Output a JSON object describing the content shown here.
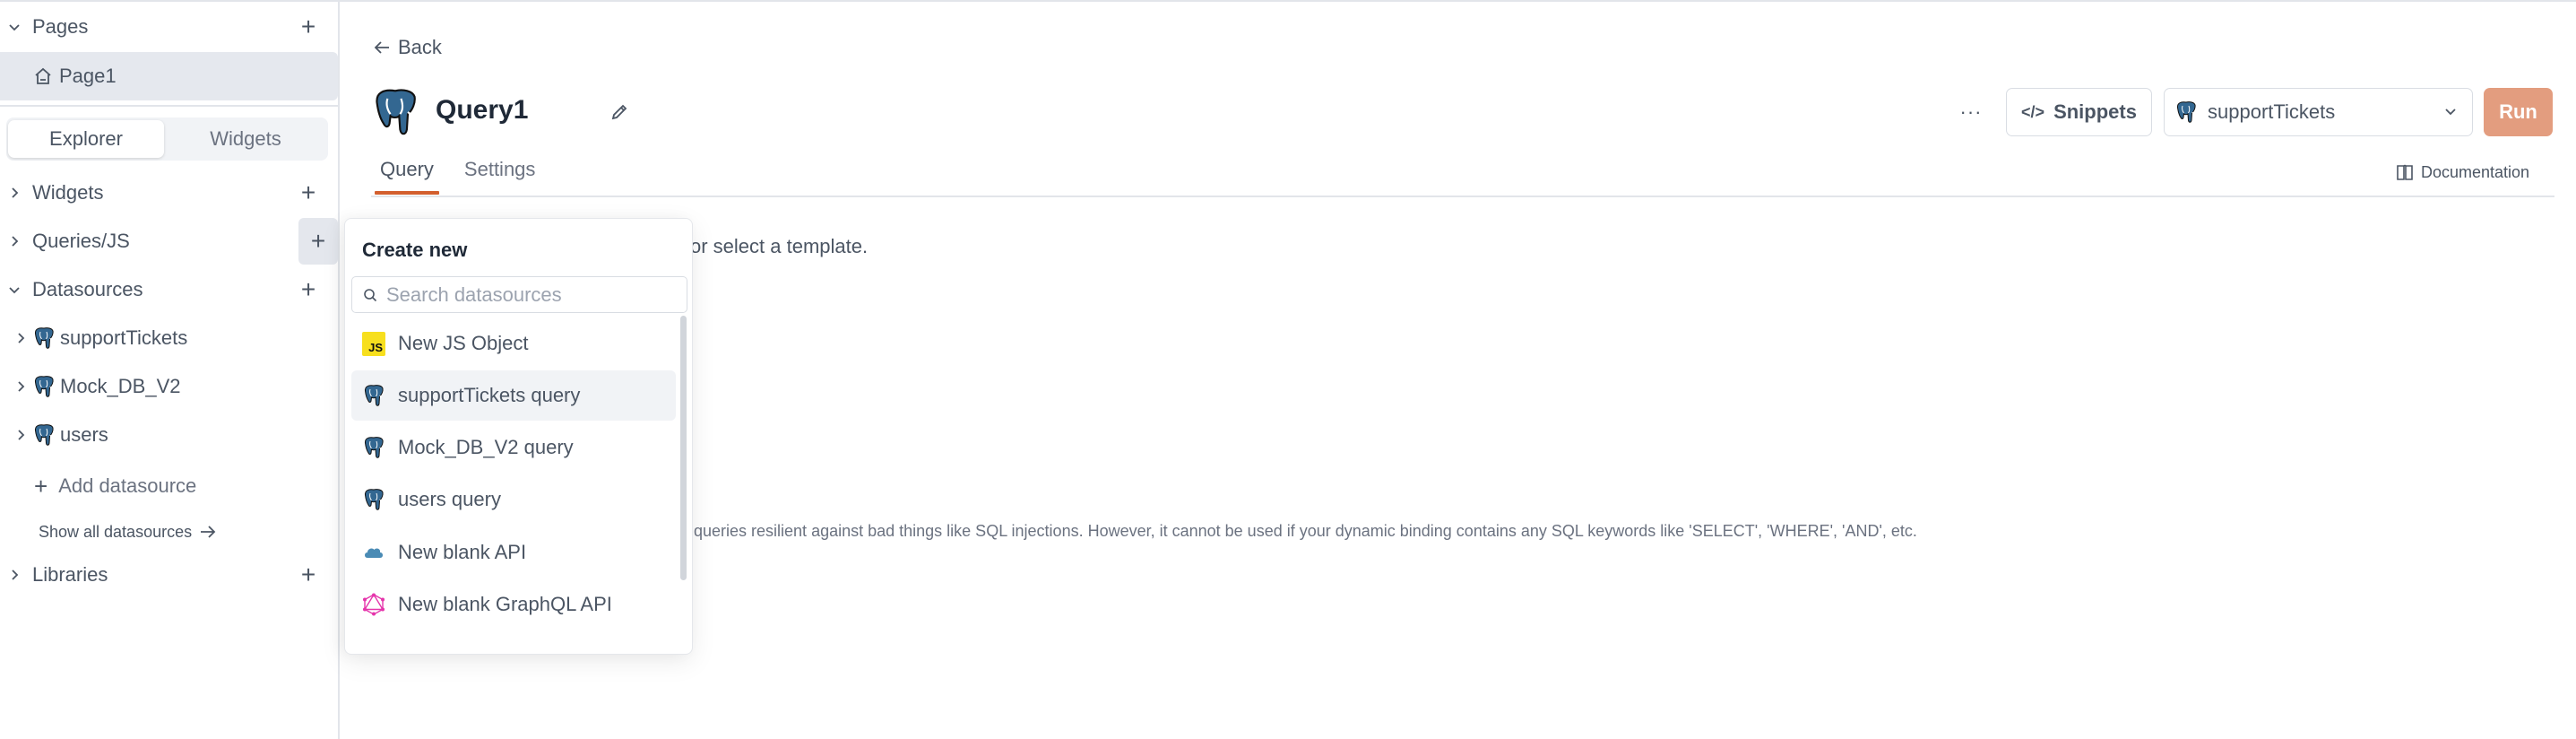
{
  "sidebar": {
    "pages": {
      "label": "Pages",
      "items": [
        {
          "label": "Page1"
        }
      ]
    },
    "segmented": {
      "options": [
        "Explorer",
        "Widgets"
      ],
      "selected": "Explorer"
    },
    "sections": {
      "widgets": "Widgets",
      "queries": "Queries/JS",
      "datasources": "Datasources",
      "libraries": "Libraries"
    },
    "datasources": [
      {
        "label": "supportTickets",
        "icon": "postgres-icon"
      },
      {
        "label": "Mock_DB_V2",
        "icon": "postgres-icon"
      },
      {
        "label": "users",
        "icon": "postgres-icon"
      }
    ],
    "add_datasource": "Add datasource",
    "show_all": "Show all datasources"
  },
  "header": {
    "back": "Back",
    "title": "Query1",
    "tabs": [
      {
        "label": "Query",
        "active": true
      },
      {
        "label": "Settings",
        "active": false
      }
    ],
    "more": "···",
    "snippets": "Snippets",
    "datasource_select": "supportTickets",
    "run": "Run",
    "documentation": "Documentation"
  },
  "content": {
    "hint": "or select a template.",
    "note": "queries resilient against bad things like SQL injections. However, it cannot be used if your dynamic binding contains any SQL keywords like 'SELECT', 'WHERE', 'AND', etc."
  },
  "popover": {
    "title": "Create new",
    "search_placeholder": "Search datasources",
    "items": [
      {
        "label": "New JS Object",
        "icon": "js-icon"
      },
      {
        "label": "supportTickets query",
        "icon": "postgres-icon",
        "hovered": true
      },
      {
        "label": "Mock_DB_V2 query",
        "icon": "postgres-icon"
      },
      {
        "label": "users query",
        "icon": "postgres-icon"
      },
      {
        "label": "New blank API",
        "icon": "cloud-icon"
      },
      {
        "label": "New blank GraphQL API",
        "icon": "graphql-icon"
      }
    ]
  },
  "colors": {
    "accent": "#d35f2e",
    "run_button": "#e39d7f",
    "postgres": "#336791",
    "graphql": "#e535ab",
    "js": "#f7df1e",
    "selected_bg": "#e5e8ee"
  }
}
